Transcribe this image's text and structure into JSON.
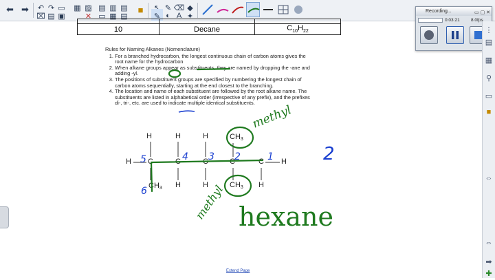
{
  "toolbar": {
    "icons": [
      "back-arrow",
      "forward-arrow",
      "undo",
      "redo",
      "screen",
      "save",
      "insert-table",
      "clear-page",
      "delete",
      "select",
      "pen-tool",
      "fill",
      "eraser",
      "shapes",
      "lines",
      "text",
      "pen-colors",
      "highlighter-pens",
      "creative-pen",
      "line-tool",
      "table-tool",
      "screen-shade"
    ]
  },
  "table": {
    "rows": [
      {
        "n": "",
        "name": "",
        "formula": ""
      },
      {
        "n": "10",
        "name": "Decane",
        "formula_main": "C",
        "formula_sub1": "10",
        "formula_h": "H",
        "formula_sub2": "22"
      }
    ]
  },
  "rules": {
    "title": "Rules for Naming Alkanes (Nomenclature)",
    "items": [
      "For a branched hydrocarbon, the longest continuous chain of carbon atoms gives the root name for the hydrocarbon",
      "When alkane groups appear as substituents, they are named by dropping the -ane and adding -yl.",
      "The positions of substituent groups are specified by numbering the longest chain of carbon atoms sequentially, starting at the end closest to the branching.",
      "The location and name of each substituent are followed by the root alkane name. The substituents are listed in alphabetical order (irrespective of any prefix), and the prefixes di-, tri-, etc. are used to indicate multiple identical substituents."
    ]
  },
  "molecule": {
    "H": "H",
    "C": "C",
    "CH3": "CH",
    "sub3": "3"
  },
  "handwriting": {
    "numbers": [
      "5",
      "4",
      "3",
      "2",
      "1",
      "6"
    ],
    "methyl_top": "methyl",
    "methyl_bottom": "methyl",
    "hexane": "hexane",
    "side_number": "2"
  },
  "recorder": {
    "title": "Recording...",
    "time": "0:03:21",
    "fps": "8.0fps"
  },
  "footer": {
    "link": "Extend Page"
  },
  "colors": {
    "ink_green": "#1f7a1f",
    "ink_blue": "#1a3fd0",
    "toolbar_bg": "#eef1f5"
  }
}
